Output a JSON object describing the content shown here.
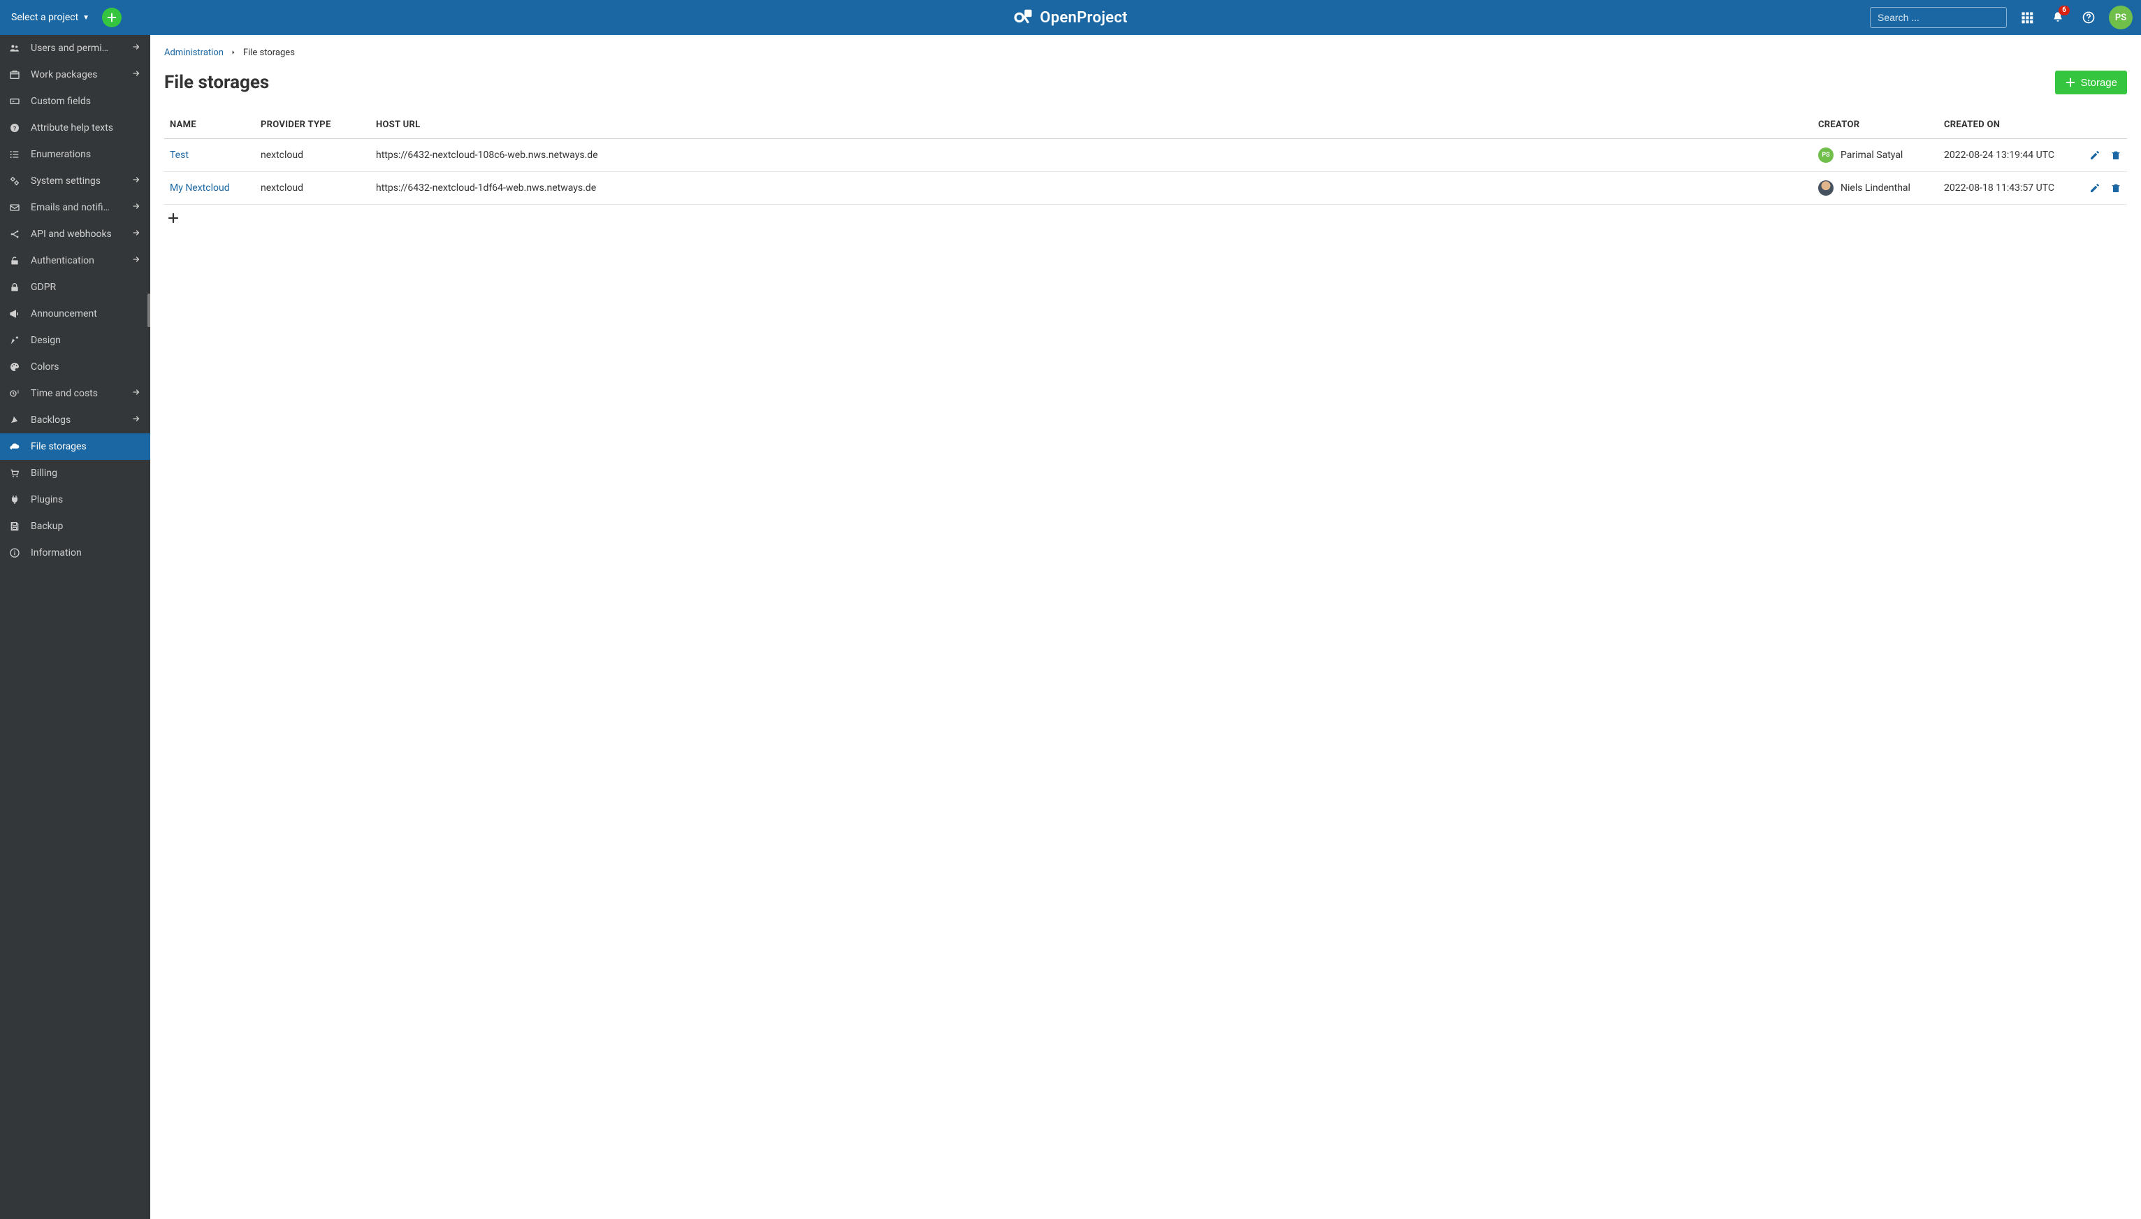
{
  "topbar": {
    "project_select": "Select a project",
    "search_placeholder": "Search ...",
    "notification_count": "6",
    "avatar_initials": "PS",
    "logo_text": "OpenProject"
  },
  "sidebar": {
    "items": [
      {
        "icon": "users",
        "label": "Users and permi…",
        "arrow": true,
        "active": false
      },
      {
        "icon": "workpkg",
        "label": "Work packages",
        "arrow": true,
        "active": false
      },
      {
        "icon": "custom",
        "label": "Custom fields",
        "arrow": false,
        "active": false
      },
      {
        "icon": "help",
        "label": "Attribute help texts",
        "arrow": false,
        "active": false
      },
      {
        "icon": "enum",
        "label": "Enumerations",
        "arrow": false,
        "active": false
      },
      {
        "icon": "gears",
        "label": "System settings",
        "arrow": true,
        "active": false
      },
      {
        "icon": "mail",
        "label": "Emails and notifi…",
        "arrow": true,
        "active": false
      },
      {
        "icon": "api",
        "label": "API and webhooks",
        "arrow": true,
        "active": false
      },
      {
        "icon": "lockopen",
        "label": "Authentication",
        "arrow": true,
        "active": false
      },
      {
        "icon": "lock",
        "label": "GDPR",
        "arrow": false,
        "active": false
      },
      {
        "icon": "announce",
        "label": "Announcement",
        "arrow": false,
        "active": false
      },
      {
        "icon": "design",
        "label": "Design",
        "arrow": false,
        "active": false
      },
      {
        "icon": "colors",
        "label": "Colors",
        "arrow": false,
        "active": false
      },
      {
        "icon": "time",
        "label": "Time and costs",
        "arrow": true,
        "active": false
      },
      {
        "icon": "backlogs",
        "label": "Backlogs",
        "arrow": true,
        "active": false
      },
      {
        "icon": "cloud",
        "label": "File storages",
        "arrow": false,
        "active": true
      },
      {
        "icon": "cart",
        "label": "Billing",
        "arrow": false,
        "active": false
      },
      {
        "icon": "plug",
        "label": "Plugins",
        "arrow": false,
        "active": false
      },
      {
        "icon": "save",
        "label": "Backup",
        "arrow": false,
        "active": false
      },
      {
        "icon": "info",
        "label": "Information",
        "arrow": false,
        "active": false
      }
    ]
  },
  "breadcrumb": {
    "root": "Administration",
    "current": "File storages"
  },
  "page": {
    "title": "File storages",
    "storage_btn": "Storage"
  },
  "table": {
    "headers": {
      "name": "NAME",
      "provider": "PROVIDER TYPE",
      "host": "HOST URL",
      "creator": "CREATOR",
      "created": "CREATED ON"
    },
    "rows": [
      {
        "name": "Test",
        "provider": "nextcloud",
        "host": "https://6432-nextcloud-108c6-web.nws.netways.de",
        "creator": "Parimal Satyal",
        "avatar": "ps",
        "initials": "PS",
        "created": "2022-08-24 13:19:44 UTC"
      },
      {
        "name": "My Nextcloud",
        "provider": "nextcloud",
        "host": "https://6432-nextcloud-1df64-web.nws.netways.de",
        "creator": "Niels Lindenthal",
        "avatar": "photo",
        "initials": "",
        "created": "2022-08-18 11:43:57 UTC"
      }
    ]
  }
}
